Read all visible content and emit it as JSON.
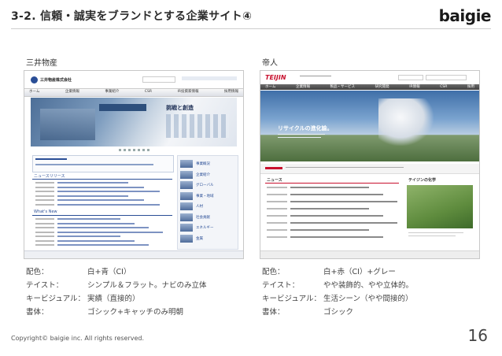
{
  "header": {
    "title": "3-2. 信頼・誠実をブランドとする企業サイト④",
    "logo": "baigie"
  },
  "left": {
    "company": "三井物産",
    "screenshot": {
      "site_name": "三井物産株式会社",
      "hero_text": "挑戦と創造",
      "news_heading": "ニュースリリース",
      "whatsnew_heading": "What's New",
      "nav_items": [
        "ホーム",
        "企業情報",
        "事業紹介",
        "CSR",
        "IR投資家情報",
        "採用情報"
      ],
      "side_items": [
        "事業概況",
        "企業紹介",
        "グローバル",
        "事業・地域",
        "人材",
        "社会貢献",
        "エネルギー",
        "金属"
      ]
    },
    "props": [
      {
        "label": "配色：",
        "value": "白+青（CI）"
      },
      {
        "label": "テイスト：",
        "value": "シンプル＆フラット。ナビのみ立体"
      },
      {
        "label": "キービジュアル：",
        "value": "実績（直接的）"
      },
      {
        "label": "書体：",
        "value": "ゴシック+キャッチのみ明朝"
      }
    ]
  },
  "right": {
    "company": "帝人",
    "screenshot": {
      "brand": "TEIJIN",
      "hero_text": "リサイクルの進化論。",
      "news_heading": "ニュース",
      "side_heading": "テイジンの化学",
      "nav_items": [
        "ホーム",
        "企業情報",
        "製品・サービス",
        "研究開発",
        "IR情報",
        "CSR",
        "採用"
      ]
    },
    "props": [
      {
        "label": "配色：",
        "value": "白+赤（CI）+グレー"
      },
      {
        "label": "テイスト：",
        "value": "やや装飾的、やや立体的。"
      },
      {
        "label": "キービジュアル：",
        "value": "生活シーン（やや間接的）"
      },
      {
        "label": "書体：",
        "value": "ゴシック"
      }
    ]
  },
  "footer": {
    "copyright": "Copyright© baigie inc. All rights reserved.",
    "page": "16"
  },
  "colors": {
    "mitsui_blue": "#2a4e96",
    "teijin_red": "#c8102e",
    "sky": "#6c93c4"
  }
}
